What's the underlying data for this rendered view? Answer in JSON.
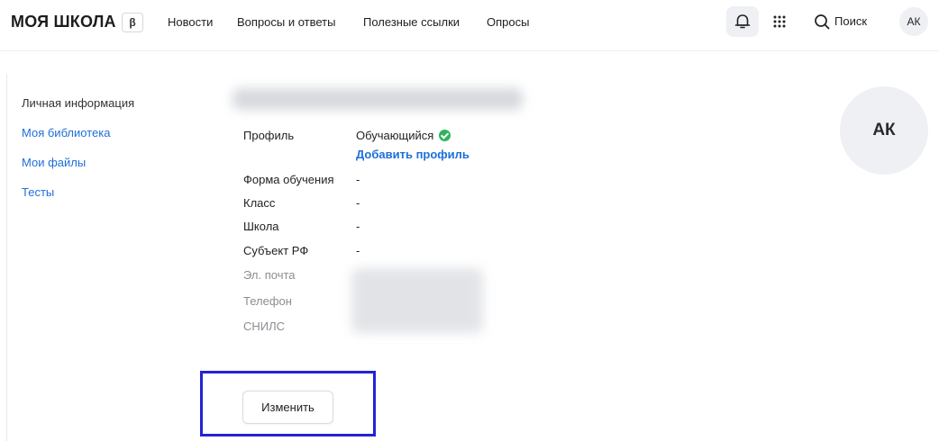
{
  "header": {
    "logo_text": "МОЯ ШКОЛА",
    "beta_label": "β",
    "nav": [
      "Новости",
      "Вопросы и ответы",
      "Полезные ссылки",
      "Опросы"
    ],
    "search_label": "Поиск",
    "avatar_initials": "АК"
  },
  "sidebar": {
    "items": [
      {
        "label": "Личная информация",
        "active": true
      },
      {
        "label": "Моя библиотека",
        "active": false
      },
      {
        "label": "Мои файлы",
        "active": false
      },
      {
        "label": "Тесты",
        "active": false
      }
    ]
  },
  "profile": {
    "fields": [
      {
        "label": "Профиль",
        "value": "Обучающийся"
      },
      {
        "label": "Форма обучения",
        "value": "-"
      },
      {
        "label": "Класс",
        "value": "-"
      },
      {
        "label": "Школа",
        "value": "-"
      },
      {
        "label": "Субъект РФ",
        "value": "-"
      }
    ],
    "add_profile_label": "Добавить профиль",
    "private_fields": [
      "Эл. почта",
      "Телефон",
      "СНИЛС"
    ],
    "avatar_initials": "АК",
    "edit_button_label": "Изменить"
  },
  "colors": {
    "accent": "#1e6fd9",
    "verified": "#2fb45a",
    "highlight_border": "#2323d6"
  },
  "icons": [
    "bell-icon",
    "apps-grid-icon",
    "search-icon",
    "check-circle-icon"
  ]
}
